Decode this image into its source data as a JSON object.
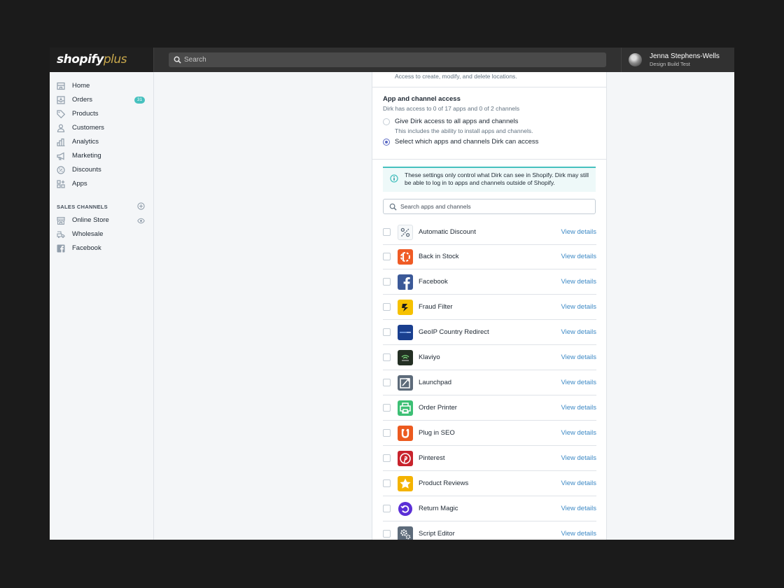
{
  "brand": {
    "wordmark": "shopify",
    "wordmark_suffix": "plus",
    "accent": "#c9a84c"
  },
  "search": {
    "placeholder": "Search"
  },
  "user": {
    "name": "Jenna Stephens-Wells",
    "store": "Design Build Test"
  },
  "sidebar": {
    "items": [
      {
        "label": "Home",
        "icon": "home-icon"
      },
      {
        "label": "Orders",
        "icon": "orders-icon",
        "badge": "31"
      },
      {
        "label": "Products",
        "icon": "tag-icon"
      },
      {
        "label": "Customers",
        "icon": "person-icon"
      },
      {
        "label": "Analytics",
        "icon": "bar-chart-icon"
      },
      {
        "label": "Marketing",
        "icon": "megaphone-icon"
      },
      {
        "label": "Discounts",
        "icon": "discount-icon"
      },
      {
        "label": "Apps",
        "icon": "apps-icon"
      }
    ],
    "channels_heading": "SALES CHANNELS",
    "channels": [
      {
        "label": "Online Store",
        "icon": "store-icon"
      },
      {
        "label": "Wholesale",
        "icon": "wholesale-icon"
      },
      {
        "label": "Facebook",
        "icon": "facebook-icon"
      }
    ]
  },
  "permissions": {
    "prev_description": "Access to create, modify, and delete locations.",
    "app_access_title": "App and channel access",
    "app_access_summary": "Dirk has access to 0 of 17 apps and 0 of 2 channels",
    "option_all_label": "Give Dirk access to all apps and channels",
    "option_all_help": "This includes the ability to install apps and channels.",
    "option_select_label": "Select which apps and channels Dirk can access",
    "selected_option": "select",
    "info_banner": "These settings only control what Dirk can see in Shopify. Dirk may still be able to log in to apps and channels outside of Shopify.",
    "search_placeholder": "Search apps and channels",
    "view_details_label": "View details"
  },
  "apps": [
    {
      "name": "Automatic Discount",
      "icon": "percent-icon",
      "color": "#ffffff"
    },
    {
      "name": "Back in Stock",
      "icon": "back-in-stock-icon",
      "color": "#ef5b25"
    },
    {
      "name": "Facebook",
      "icon": "facebook-icon",
      "color": "#3b5998"
    },
    {
      "name": "Fraud Filter",
      "icon": "fraud-filter-icon",
      "color": "#f6c100"
    },
    {
      "name": "GeoIP Country Redirect",
      "icon": "geoip-icon",
      "color": "#1a3f8f"
    },
    {
      "name": "Klaviyo",
      "icon": "klaviyo-icon",
      "color": "#232f23"
    },
    {
      "name": "Launchpad",
      "icon": "launchpad-icon",
      "color": "#5d6b7a"
    },
    {
      "name": "Order Printer",
      "icon": "printer-icon",
      "color": "#3cbf74"
    },
    {
      "name": "Plug in SEO",
      "icon": "plug-in-seo-icon",
      "color": "#ec5a1f"
    },
    {
      "name": "Pinterest",
      "icon": "pinterest-icon",
      "color": "#c8232c"
    },
    {
      "name": "Product Reviews",
      "icon": "star-icon",
      "color": "#f4b300"
    },
    {
      "name": "Return Magic",
      "icon": "return-magic-icon",
      "color": "#5b2fd6"
    },
    {
      "name": "Script Editor",
      "icon": "gears-icon",
      "color": "#5d6b7a"
    }
  ]
}
